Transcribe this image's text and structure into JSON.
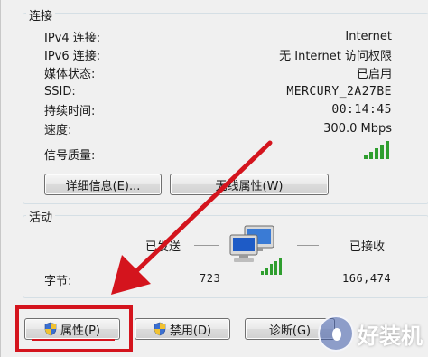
{
  "connection": {
    "title": "连接",
    "rows": [
      {
        "label": "IPv4 连接:",
        "value": "Internet"
      },
      {
        "label": "IPv6 连接:",
        "value": "无 Internet 访问权限"
      },
      {
        "label": "媒体状态:",
        "value": "已启用"
      },
      {
        "label": "SSID:",
        "value": "MERCURY_2A27BE"
      },
      {
        "label": "持续时间:",
        "value": "00:14:45"
      },
      {
        "label": "速度:",
        "value": "300.0 Mbps"
      },
      {
        "label": "信号质量:",
        "value": ""
      }
    ],
    "details_button": "详细信息(E)...",
    "wireless_props_button": "无线属性(W)"
  },
  "activity": {
    "title": "活动",
    "sent_label": "已发送",
    "received_label": "已接收",
    "bytes_label": "字节:",
    "bytes_sent": "723",
    "bytes_received": "166,474"
  },
  "buttons": {
    "properties": "属性(P)",
    "disable": "禁用(D)",
    "diagnose": "诊断(G)"
  },
  "watermark": "好装机",
  "colors": {
    "signal_green": "#2f9e2f",
    "highlight_red": "#d4141d"
  }
}
